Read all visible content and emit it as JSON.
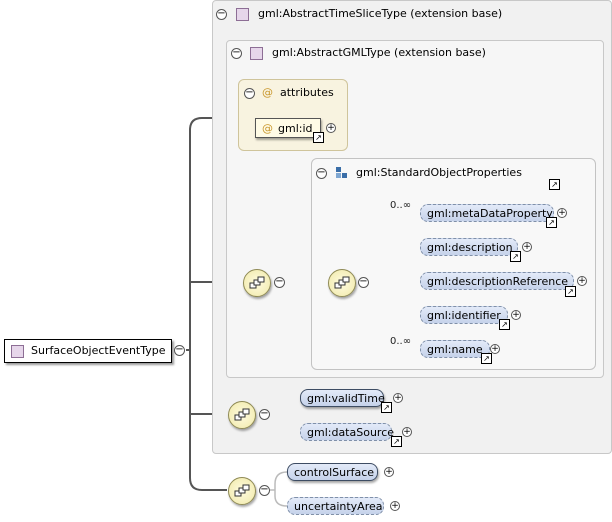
{
  "root": {
    "label": "SurfaceObjectEventType"
  },
  "abstractTimeSlice": {
    "title": "gml:AbstractTimeSliceType (extension base)"
  },
  "abstractGML": {
    "title": "gml:AbstractGMLType (extension base)"
  },
  "attributes": {
    "title": "attributes",
    "items": [
      "gml:id"
    ]
  },
  "standardObjectProperties": {
    "title": "gml:StandardObjectProperties",
    "elements": [
      {
        "label": "gml:metaDataProperty",
        "occurrence": "0..∞"
      },
      {
        "label": "gml:description",
        "occurrence": ""
      },
      {
        "label": "gml:descriptionReference",
        "occurrence": ""
      },
      {
        "label": "gml:identifier",
        "occurrence": ""
      },
      {
        "label": "gml:name",
        "occurrence": "0..∞"
      }
    ]
  },
  "timeSliceSequence": {
    "elements": [
      "gml:validTime",
      "gml:dataSource"
    ]
  },
  "ownSequence": {
    "elements": [
      "controlSurface",
      "uncertaintyArea"
    ]
  },
  "icons": {
    "collapse": "−",
    "expand": "+",
    "link": "↗",
    "attribute": "@"
  }
}
